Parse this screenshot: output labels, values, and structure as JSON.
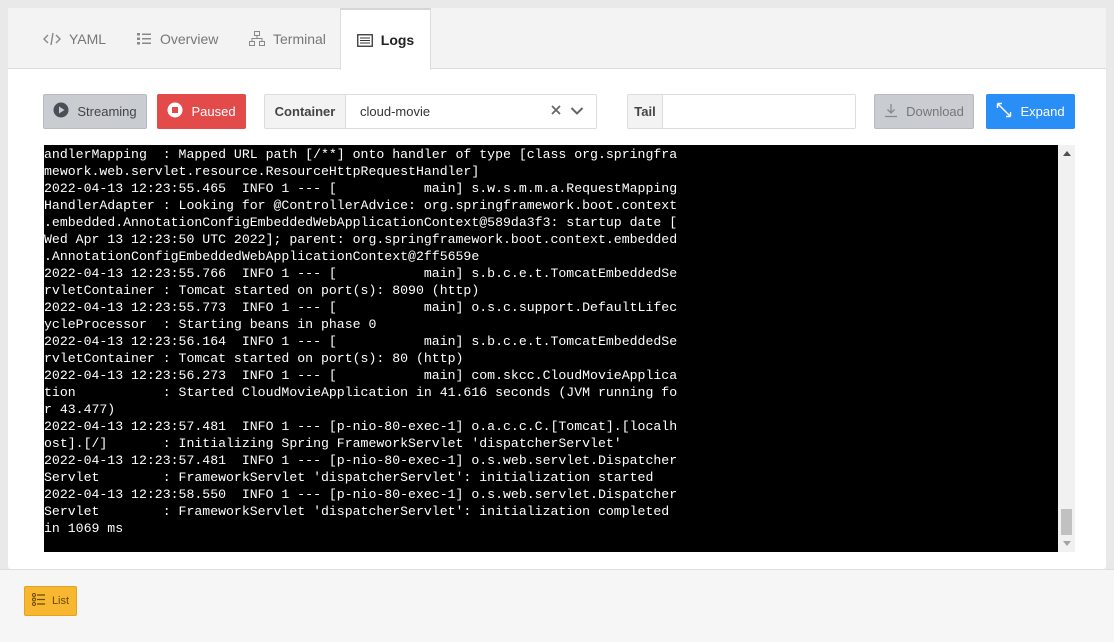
{
  "tabs": [
    {
      "label": "YAML",
      "icon": "code-icon",
      "active": false
    },
    {
      "label": "Overview",
      "icon": "list-icon",
      "active": false
    },
    {
      "label": "Terminal",
      "icon": "sitemap-icon",
      "active": false
    },
    {
      "label": "Logs",
      "icon": "logs-icon",
      "active": true
    }
  ],
  "toolbar": {
    "streaming_label": "Streaming",
    "paused_label": "Paused",
    "container_label": "Container",
    "container_value": "cloud-movie",
    "tail_label": "Tail",
    "tail_value": "",
    "download_label": "Download",
    "expand_label": "Expand"
  },
  "log_lines": [
    "andlerMapping  : Mapped URL path [/**] onto handler of type [class org.springfra",
    "mework.web.servlet.resource.ResourceHttpRequestHandler]",
    "2022-04-13 12:23:55.465  INFO 1 --- [           main] s.w.s.m.m.a.RequestMapping",
    "HandlerAdapter : Looking for @ControllerAdvice: org.springframework.boot.context",
    ".embedded.AnnotationConfigEmbeddedWebApplicationContext@589da3f3: startup date [",
    "Wed Apr 13 12:23:50 UTC 2022]; parent: org.springframework.boot.context.embedded",
    ".AnnotationConfigEmbeddedWebApplicationContext@2ff5659e",
    "2022-04-13 12:23:55.766  INFO 1 --- [           main] s.b.c.e.t.TomcatEmbeddedSe",
    "rvletContainer : Tomcat started on port(s): 8090 (http)",
    "2022-04-13 12:23:55.773  INFO 1 --- [           main] o.s.c.support.DefaultLifec",
    "ycleProcessor  : Starting beans in phase 0",
    "2022-04-13 12:23:56.164  INFO 1 --- [           main] s.b.c.e.t.TomcatEmbeddedSe",
    "rvletContainer : Tomcat started on port(s): 80 (http)",
    "2022-04-13 12:23:56.273  INFO 1 --- [           main] com.skcc.CloudMovieApplica",
    "tion           : Started CloudMovieApplication in 41.616 seconds (JVM running fo",
    "r 43.477)",
    "2022-04-13 12:23:57.481  INFO 1 --- [p-nio-80-exec-1] o.a.c.c.C.[Tomcat].[localh",
    "ost].[/]       : Initializing Spring FrameworkServlet 'dispatcherServlet'",
    "2022-04-13 12:23:57.481  INFO 1 --- [p-nio-80-exec-1] o.s.web.servlet.Dispatcher",
    "Servlet        : FrameworkServlet 'dispatcherServlet': initialization started",
    "2022-04-13 12:23:58.550  INFO 1 --- [p-nio-80-exec-1] o.s.web.servlet.Dispatcher",
    "Servlet        : FrameworkServlet 'dispatcherServlet': initialization completed",
    "in 1069 ms"
  ],
  "footer": {
    "list_label": "List"
  },
  "colors": {
    "paused": "#e34b4b",
    "expand": "#2a8ef7",
    "list": "#f7b731",
    "log_background": "#000000"
  }
}
